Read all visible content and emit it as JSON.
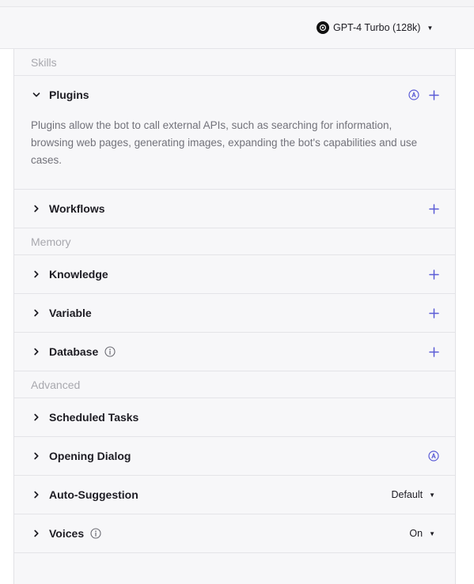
{
  "header": {
    "model_name": "GPT-4 Turbo (128k)",
    "model_icon": "openai-logo-icon"
  },
  "sections": {
    "skills_label": "Skills",
    "memory_label": "Memory",
    "advanced_label": "Advanced"
  },
  "plugins": {
    "title": "Plugins",
    "description": "Plugins allow the bot to call external APIs, such as searching for information, browsing web pages, generating images, expanding the bot's capabilities and use cases."
  },
  "rows": {
    "workflows": "Workflows",
    "knowledge": "Knowledge",
    "variable": "Variable",
    "database": "Database",
    "scheduled_tasks": "Scheduled Tasks",
    "opening_dialog": "Opening Dialog",
    "auto_suggestion": "Auto-Suggestion",
    "voices": "Voices"
  },
  "values": {
    "auto_suggestion": "Default",
    "voices": "On"
  },
  "colors": {
    "accent": "#5b5cd6",
    "muted": "#a8a8ae",
    "text": "#1d1c23"
  }
}
